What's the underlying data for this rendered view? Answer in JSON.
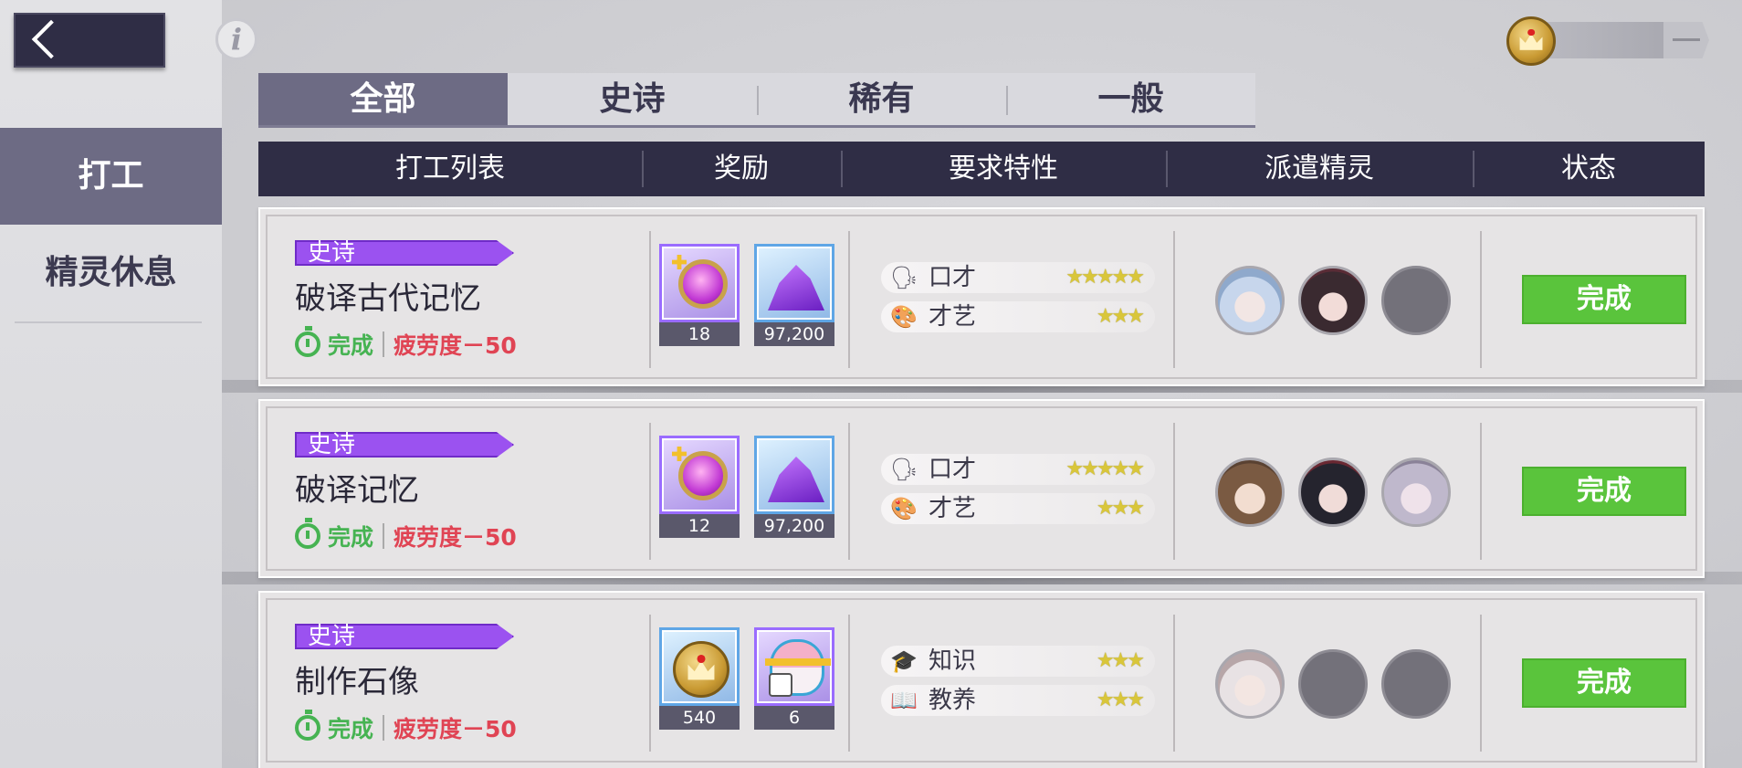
{
  "top": {
    "back_icon": "chevron-left-icon",
    "info_icon": "info-icon",
    "info_glyph": "i",
    "currency_icon": "coin-icon",
    "currency_dash": "—"
  },
  "sidebar": {
    "items": [
      {
        "label": "打工",
        "active": true
      },
      {
        "label": "精灵休息",
        "active": false
      }
    ]
  },
  "tabs": [
    {
      "label": "全部",
      "active": true
    },
    {
      "label": "史诗"
    },
    {
      "label": "稀有"
    },
    {
      "label": "一般"
    }
  ],
  "table": {
    "headers": [
      "打工列表",
      "奖励",
      "要求特性",
      "派遣精灵",
      "状态"
    ]
  },
  "jobs": [
    {
      "rarity": "史诗",
      "title": "破译古代记忆",
      "timer_text": "完成",
      "fatigue": "疲劳度－50",
      "rewards": [
        {
          "icon": "heart-amulet-icon",
          "count": "18"
        },
        {
          "icon": "purple-crystal-icon",
          "count": "97,200"
        }
      ],
      "traits": [
        {
          "icon": "speech-icon",
          "glyph": "🗣",
          "name": "口才",
          "stars": "★★★★★"
        },
        {
          "icon": "palette-icon",
          "glyph": "🎨",
          "name": "才艺",
          "stars": "★★★"
        }
      ],
      "spirits": [
        "spirit-avatar",
        "spirit-avatar",
        "empty-slot"
      ],
      "status": "完成"
    },
    {
      "rarity": "史诗",
      "title": "破译记忆",
      "timer_text": "完成",
      "fatigue": "疲劳度－50",
      "rewards": [
        {
          "icon": "heart-amulet-icon",
          "count": "12"
        },
        {
          "icon": "purple-crystal-icon",
          "count": "97,200"
        }
      ],
      "traits": [
        {
          "icon": "speech-icon",
          "glyph": "🗣",
          "name": "口才",
          "stars": "★★★★★"
        },
        {
          "icon": "palette-icon",
          "glyph": "🎨",
          "name": "才艺",
          "stars": "★★★"
        }
      ],
      "spirits": [
        "spirit-avatar",
        "spirit-avatar",
        "spirit-avatar"
      ],
      "status": "完成"
    },
    {
      "rarity": "史诗",
      "title": "制作石像",
      "timer_text": "完成",
      "fatigue": "疲劳度－50",
      "rewards": [
        {
          "icon": "gold-coin-icon",
          "count": "540"
        },
        {
          "icon": "gift-box-icon",
          "count": "6"
        }
      ],
      "traits": [
        {
          "icon": "graduation-cap-icon",
          "glyph": "🎓",
          "name": "知识",
          "stars": "★★★"
        },
        {
          "icon": "book-icon",
          "glyph": "📖",
          "name": "教养",
          "stars": "★★★"
        }
      ],
      "spirits": [
        "spirit-avatar",
        "empty-slot",
        "empty-slot"
      ],
      "status": "完成"
    }
  ]
}
